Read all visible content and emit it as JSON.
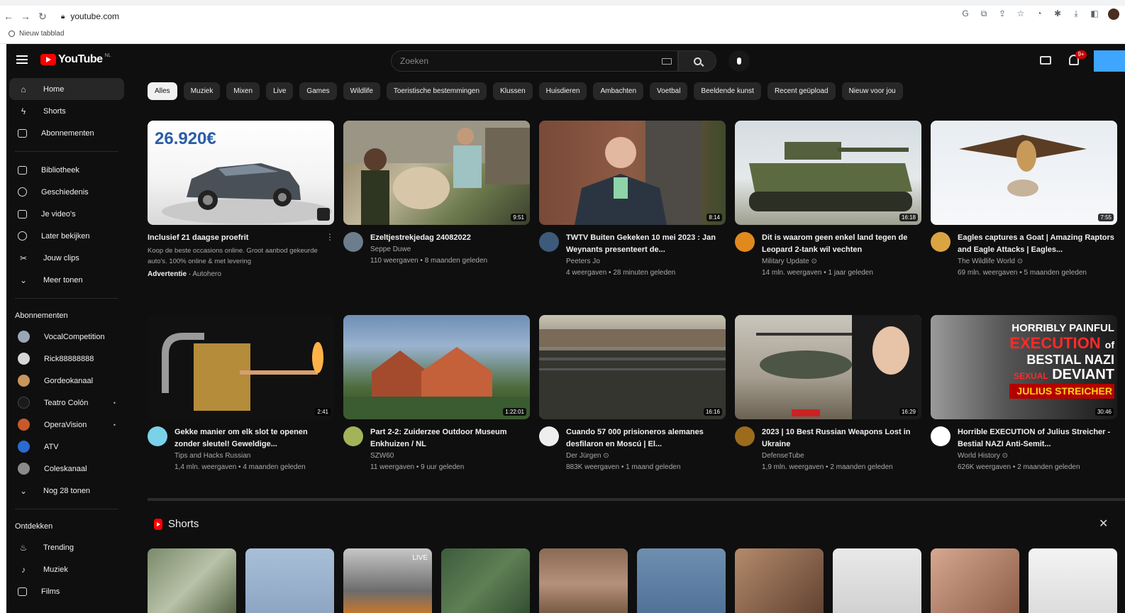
{
  "browser": {
    "url": "youtube.com",
    "bookmark": "Nieuw tabblad"
  },
  "masthead": {
    "logo": "YouTube",
    "logo_country": "NL",
    "search_placeholder": "Zoeken",
    "notifications_badge": "9+"
  },
  "sidebar": {
    "main": [
      {
        "label": "Home",
        "icon": "home-icon"
      },
      {
        "label": "Shorts",
        "icon": "shorts-icon"
      },
      {
        "label": "Abonnementen",
        "icon": "subscriptions-icon"
      }
    ],
    "library": [
      {
        "label": "Bibliotheek",
        "icon": "library-icon"
      },
      {
        "label": "Geschiedenis",
        "icon": "history-icon"
      },
      {
        "label": "Je video's",
        "icon": "your-videos-icon"
      },
      {
        "label": "Later bekijken",
        "icon": "watch-later-icon"
      },
      {
        "label": "Jouw clips",
        "icon": "clips-icon"
      },
      {
        "label": "Meer tonen",
        "icon": "chevron-down-icon"
      }
    ],
    "subs_heading": "Abonnementen",
    "subs": [
      {
        "label": "VocalCompetition",
        "color": "#9aa7b8"
      },
      {
        "label": "Rick88888888",
        "color": "#d6d6d6"
      },
      {
        "label": "Gordeokanaal",
        "color": "#c8955a"
      },
      {
        "label": "Teatro Colón",
        "color": "#1a1a1a"
      },
      {
        "label": "OperaVision",
        "color": "#c85a2a"
      },
      {
        "label": "ATV",
        "color": "#2a6bd1"
      },
      {
        "label": "Coleskanaal",
        "color": "#8a8a8a"
      }
    ],
    "more_subs": "Nog 28 tonen",
    "explore_heading": "Ontdekken",
    "explore": [
      {
        "label": "Trending",
        "icon": "trending-icon"
      },
      {
        "label": "Muziek",
        "icon": "music-icon"
      },
      {
        "label": "Films",
        "icon": "films-icon"
      }
    ]
  },
  "chips": [
    "Alles",
    "Muziek",
    "Mixen",
    "Live",
    "Games",
    "Wildlife",
    "Toeristische bestemmingen",
    "Klussen",
    "Huisdieren",
    "Ambachten",
    "Voetbal",
    "Beeldende kunst",
    "Recent geüpload",
    "Nieuw voor jou"
  ],
  "ad": {
    "price": "26.920€",
    "title": "Inclusief 21 daagse proefrit",
    "desc": "Koop de beste occasions online. Groot aanbod gekeurde auto's. 100% online & met levering",
    "label": "Advertentie",
    "advertiser": "Autohero"
  },
  "videos_row1": [
    {
      "title": "Ezeltjestrekjedag 24082022",
      "channel": "Seppe Duwe",
      "stats": "110 weergaven • 8 maanden geleden",
      "duration": "9:51"
    },
    {
      "title": "TWTV Buiten Gekeken 10 mei 2023 : Jan Weynants presenteert de...",
      "channel": "Peeters Jo",
      "stats": "4 weergaven • 28 minuten geleden",
      "duration": "8:14"
    },
    {
      "title": "Dit is waarom geen enkel land tegen de Leopard 2-tank wil vechten",
      "channel": "Military Update ⊙",
      "stats": "14 mln. weergaven • 1 jaar geleden",
      "duration": "16:18"
    },
    {
      "title": "Eagles captures a Goat | Amazing Raptors and Eagle Attacks | Eagles...",
      "channel": "The Wildlife World ⊙",
      "stats": "69 mln. weergaven • 5 maanden geleden",
      "duration": "7:55"
    }
  ],
  "videos_row2": [
    {
      "title": "Gekke manier om elk slot te openen zonder sleutel! Geweldige...",
      "channel": "Tips and Hacks Russian",
      "stats": "1,4 mln. weergaven • 4 maanden geleden",
      "duration": "2:41"
    },
    {
      "title": "Part 2-2: Zuiderzee Outdoor Museum Enkhuizen / NL",
      "channel": "SZW60",
      "stats": "11 weergaven • 9 uur geleden",
      "duration": "1:22:01"
    },
    {
      "title": "Cuando 57 000 prisioneros alemanes desfilaron en Moscú | El...",
      "channel": "Der Jürgen ⊙",
      "stats": "883K weergaven • 1 maand geleden",
      "duration": "16:16"
    },
    {
      "title": "2023 | 10 Best Russian Weapons Lost in Ukraine",
      "channel": "DefenseTube",
      "stats": "1,9 mln. weergaven • 2 maanden geleden",
      "duration": "16:29"
    },
    {
      "title": "Horrible EXECUTION of Julius Streicher - Bestial NAZI Anti-Semit...",
      "channel": "World History ⊙",
      "stats": "626K weergaven • 2 maanden geleden",
      "duration": "30:46"
    }
  ],
  "thumb5_text": {
    "line1": "HORRIBLY PAINFUL",
    "line2": "EXECUTION",
    "line2b": "of",
    "line3": "BESTIAL NAZI",
    "line4a": "SEXUAL",
    "line4b": "DEVIANT",
    "line5": "JULIUS STREICHER"
  },
  "shorts": {
    "heading": "Shorts",
    "live": "LIVE"
  }
}
